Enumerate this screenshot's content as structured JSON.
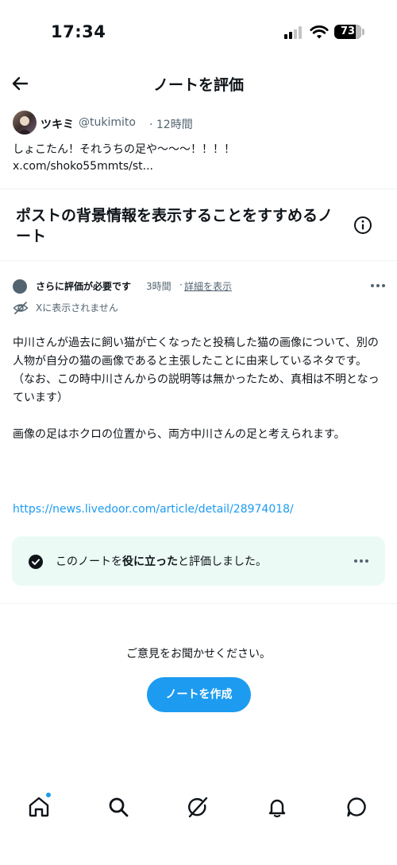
{
  "status_bar": {
    "time": "17:34",
    "battery": "73"
  },
  "header": {
    "title": "ノートを評価"
  },
  "post": {
    "author_name": "ツキミ",
    "author_handle": "@tukimito",
    "time": "· 12時間",
    "text": "しょこたん！それうちの足や〜〜〜！！！！",
    "link": "x.com/shoko55mmts/st..."
  },
  "note_type": "ポストの背景情報を表示することをすすめるノート",
  "note": {
    "status": "さらに評価が必要です",
    "time": "3時間",
    "separator": "·",
    "detail_link": "詳細を表示",
    "visibility": "Xに表示されません",
    "paragraphs": [
      "中川さんが過去に飼い猫が亡くなったと投稿した猫の画像について、別の人物が自分の猫の画像であると主張したことに由来しているネタです。",
      "（なお、この時中川さんからの説明等は無かったため、真相は不明となっています）",
      "画像の足はホクロの位置から、両方中川さんの足と考えられます。"
    ],
    "source_url": "https://news.livedoor.com/article/detail/28974018/"
  },
  "rating": {
    "prefix": "このノートを",
    "emphasis": "役に立った",
    "suffix": "と評価しました。"
  },
  "feedback": {
    "prompt": "ご意見をお聞かせください。",
    "button_label": "ノートを作成"
  },
  "tabs": [
    "home-icon",
    "search-icon",
    "grok-icon",
    "notifications-icon",
    "messages-icon"
  ],
  "colors": {
    "accent": "#1d9bf0",
    "rated_bg": "#ebfaf4",
    "secondary_text": "#536471"
  }
}
